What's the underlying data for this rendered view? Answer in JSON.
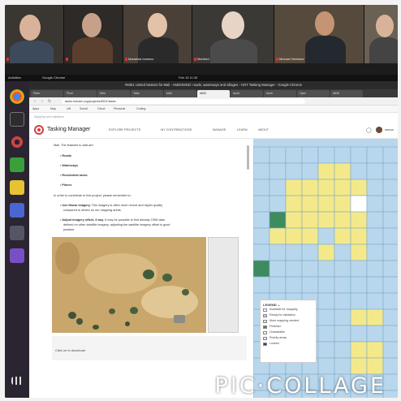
{
  "video_call": {
    "participants": [
      {
        "name": "",
        "bg": "#3a3631",
        "skin": "#d8b39a",
        "shirt": "#3d4a5c"
      },
      {
        "name": "",
        "bg": "#2d2a28",
        "skin": "#c7a08a",
        "shirt": "#5a3f2f"
      },
      {
        "name": "Madalina Ionescu",
        "bg": "#4a4038",
        "skin": "#e2c2a8",
        "shirt": "#2a2a2a"
      },
      {
        "name": "Manfred",
        "bg": "#3b3936",
        "skin": "#e8d4c6",
        "shirt": "#4b4b4b"
      },
      {
        "name": "Michael Nemtsev",
        "bg": "#564a3c",
        "skin": "#c59474",
        "shirt": "#24292f"
      },
      {
        "name": "",
        "bg": "#6b6054",
        "skin": "#d8b39a",
        "shirt": "#444"
      }
    ]
  },
  "os_bar": {
    "activities": "Activities",
    "app": "Google Chrome",
    "clock": "Feb 15 11:33"
  },
  "browser": {
    "window_title": "#8301 United Nations for Mali - AMDOMGD: roads, waterways and villages - HOT Tasking Manager - Google Chrome",
    "tabs": [
      "Plain",
      "Pinel",
      "Mfur",
      "Tabs",
      "Mail",
      "#830",
      "landr",
      "landr",
      "Oper",
      "#830"
    ],
    "url": "tasks.hotosm.org/projects/8301/tasks",
    "bookmarks": [
      "Apps",
      "Map",
      "UN",
      "Social",
      "Cloud",
      "Personal",
      "Coding"
    ]
  },
  "page": {
    "breadcrumb": "Mapping and validation",
    "app_title": "Tasking Manager",
    "nav": [
      "EXPLORE PROJECTS",
      "MY CONTRIBUTIONS",
      "MANAGE",
      "LEARN",
      "ABOUT"
    ],
    "user": "sarcun",
    "intro": "Mali. The features to add are:",
    "features": [
      "Roads",
      "Waterways",
      "Residential areas",
      "Places"
    ],
    "remember": "In order to contribute to this project, please remember to:",
    "tip1_bold": "Use Maxar imagery.",
    "tip1_rest_line1": " This imagery is often more recent and higher quality",
    "tip1_line2": "compared to others on our mapping areas.",
    "tip2_bold": "Adjust imagery offset, if any.",
    "tip2_rest_line1": " It may be possible to find already OSM data",
    "tip2_line2": "defined on other satellite imagery, adjusting the satellite imagery offset is good",
    "tip2_line3": "practice.",
    "bottom_toolbar": "Click on to download"
  },
  "legend": {
    "title": "LEGEND",
    "items": [
      {
        "label": "Available for mapping",
        "color": "#ffffff"
      },
      {
        "label": "Ready for validation",
        "color": "#b9d7ec"
      },
      {
        "label": "More mapping needed",
        "color": "#e3e3e3"
      },
      {
        "label": "Finished",
        "color": "#3e8b5f"
      },
      {
        "label": "Unavailable",
        "color": "#f4f4f4"
      },
      {
        "label": "Priority areas",
        "color": "#dfe8f3"
      },
      {
        "label": "Locked",
        "color": "#444444"
      }
    ]
  },
  "watermark": "PIC·COLLAGE",
  "colors": {
    "map_blue": "#b9d7ec",
    "map_yellow": "#f4e98a",
    "map_green": "#3e8b5f",
    "map_white": "#ffffff",
    "brand_red": "#d73f3f"
  }
}
